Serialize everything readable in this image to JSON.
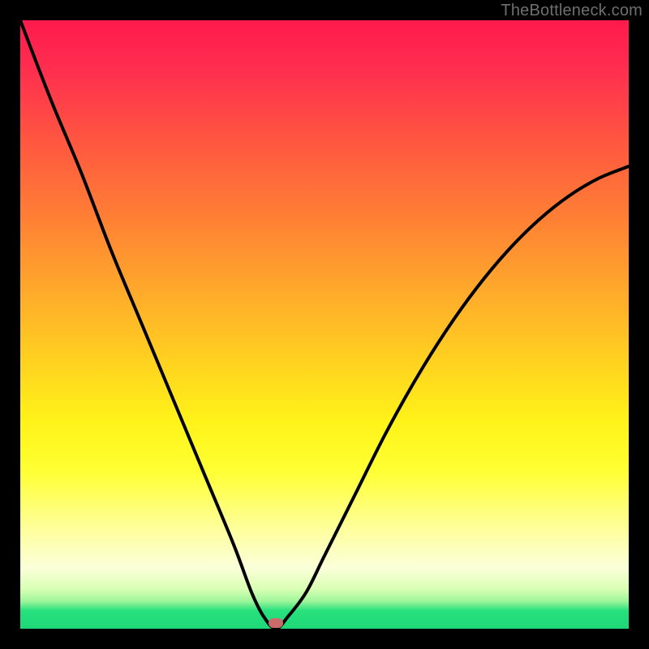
{
  "watermark": "TheBottleneck.com",
  "colors": {
    "background": "#000000",
    "gradient_top": "#ff1a4d",
    "gradient_bottom": "#1dd777",
    "curve": "#000000",
    "marker": "#c96b6b"
  },
  "chart_data": {
    "type": "line",
    "title": "",
    "xlabel": "",
    "ylabel": "",
    "xlim": [
      0,
      100
    ],
    "ylim": [
      0,
      100
    ],
    "grid": false,
    "legend": false,
    "marker": {
      "x": 42,
      "y": 1
    },
    "series": [
      {
        "name": "bottleneck-curve",
        "x": [
          0,
          5,
          10,
          15,
          20,
          25,
          30,
          35,
          38,
          40,
          42,
          44,
          47,
          50,
          55,
          60,
          65,
          70,
          75,
          80,
          85,
          90,
          95,
          100
        ],
        "y": [
          100,
          87,
          75,
          62,
          50,
          38,
          26,
          14,
          6,
          2,
          0,
          2,
          6,
          12,
          22,
          32,
          41,
          49,
          56,
          62,
          67,
          71,
          74,
          76
        ]
      }
    ]
  }
}
